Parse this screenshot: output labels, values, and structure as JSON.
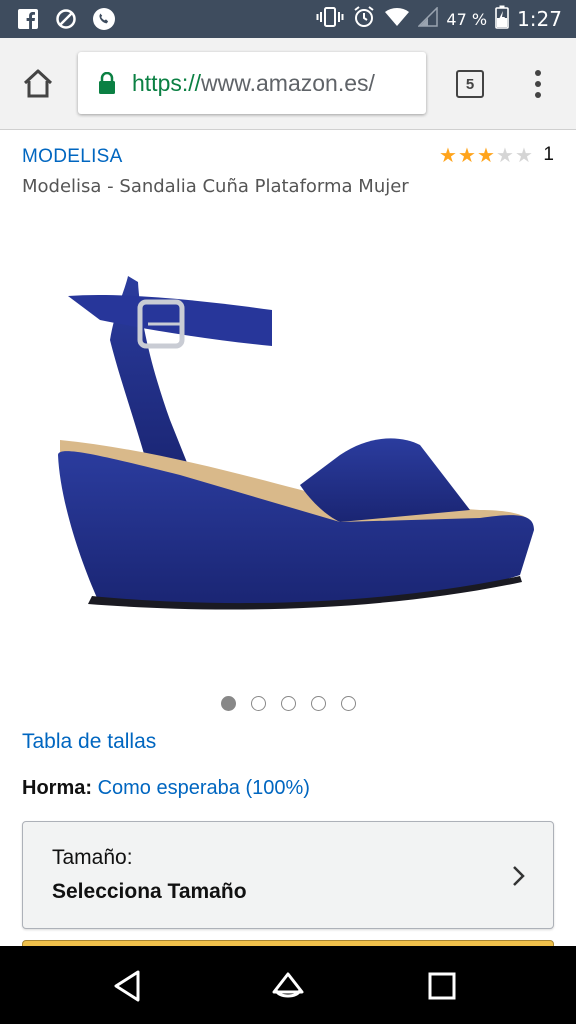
{
  "status_bar": {
    "left_icons": [
      "facebook-icon",
      "blocked-icon",
      "phone-icon"
    ],
    "right_icons": [
      "vibrate-icon",
      "alarm-icon",
      "wifi-icon",
      "signal-icon"
    ],
    "battery_percent": "47 %",
    "time": "1:27"
  },
  "browser": {
    "url_scheme": "https://",
    "url_host": "www.amazon.es/",
    "tab_count": "5"
  },
  "product": {
    "brand": "MODELISA",
    "rating_stars": 3,
    "rating_max": 5,
    "rating_count": "1",
    "title": "Modelisa - Sandalia Cuña Plataforma Mujer",
    "image_count": 5,
    "image_active_index": 0,
    "size_chart_link": "Tabla de tallas",
    "fit_label": "Horma:",
    "fit_value": "Como esperaba (100%)",
    "size_selector_label": "Tamaño:",
    "size_selector_value": "Selecciona Tamaño"
  },
  "colors": {
    "status_bar": "#3e4c5e",
    "link": "#0066c0",
    "star": "#ffa41c",
    "secure_scheme": "#0b8043",
    "shoe": "#1f2f8a"
  }
}
